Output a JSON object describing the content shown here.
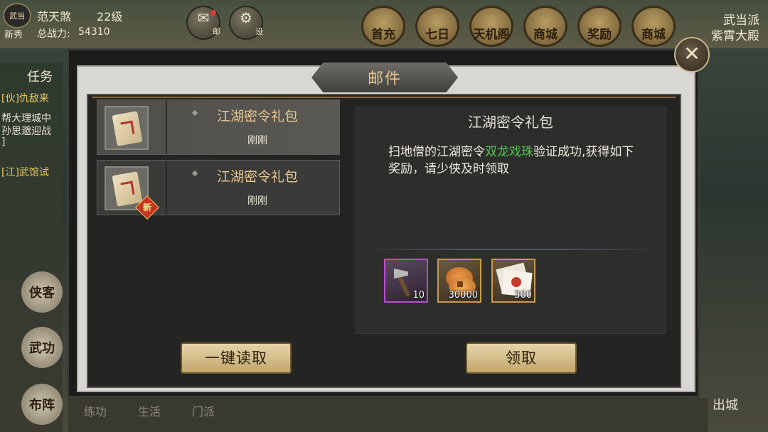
{
  "hud": {
    "avatar_text": "武当",
    "player_name": "范天煞",
    "level": "22级",
    "rank": "新秀",
    "power_label": "总战力:",
    "power_value": "54310",
    "mail_label": "邮",
    "settings_label": "设",
    "menu": [
      "首充",
      "七日",
      "天机阁",
      "商城",
      "奖励",
      "商城"
    ],
    "sect": "武当派",
    "location": "紫霄大殿",
    "left_title": "任务",
    "tasks": [
      "[伙]仇敌来",
      "帮大理城中",
      "孙思邈迎战",
      "]",
      "[江]武馆试"
    ],
    "left_buttons": [
      "侠客",
      "武功",
      "布阵"
    ],
    "bottom_tabs": [
      "练功",
      "生活",
      "门派"
    ],
    "out_city": "出城"
  },
  "dialog": {
    "title": "邮件",
    "close_symbol": "✕"
  },
  "mail_list": [
    {
      "title": "江湖密令礼包",
      "time": "刚刚",
      "is_new": false,
      "selected": true
    },
    {
      "title": "江湖密令礼包",
      "time": "刚刚",
      "is_new": true,
      "badge": "新",
      "selected": false
    }
  ],
  "detail": {
    "title": "江湖密令礼包",
    "body_before": "扫地僧的江湖密令",
    "item_name": "双龙戏珠",
    "body_after": "验证成功,获得如下奖励，请少侠及时领取",
    "item_color": "#4cc84a"
  },
  "rewards": [
    {
      "icon": "pickaxe-icon",
      "count": "10",
      "quality": "purple"
    },
    {
      "icon": "copper-coin-icon",
      "count": "30000",
      "quality": "gold"
    },
    {
      "icon": "paper-note-icon",
      "count": "300",
      "quality": "gold"
    }
  ],
  "buttons": {
    "read_all": "一键读取",
    "claim": "领取"
  }
}
